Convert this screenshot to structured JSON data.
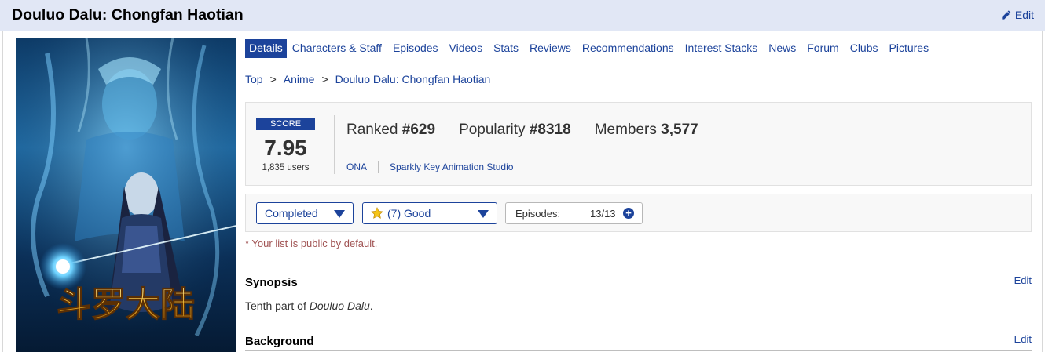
{
  "header": {
    "title": "Douluo Dalu: Chongfan Haotian",
    "edit_label": "Edit"
  },
  "poster": {
    "logo_text": "斗罗大陆"
  },
  "nav": {
    "tabs": [
      {
        "label": "Details",
        "active": true
      },
      {
        "label": "Characters & Staff"
      },
      {
        "label": "Episodes"
      },
      {
        "label": "Videos"
      },
      {
        "label": "Stats"
      },
      {
        "label": "Reviews"
      },
      {
        "label": "Recommendations"
      },
      {
        "label": "Interest Stacks"
      },
      {
        "label": "News"
      },
      {
        "label": "Forum"
      },
      {
        "label": "Clubs"
      },
      {
        "label": "Pictures"
      }
    ]
  },
  "breadcrumb": {
    "items": [
      "Top",
      "Anime",
      "Douluo Dalu: Chongfan Haotian"
    ],
    "separator": ">"
  },
  "stats": {
    "score_label": "SCORE",
    "score": "7.95",
    "users": "1,835 users",
    "ranked_label": "Ranked",
    "ranked_value": "#629",
    "popularity_label": "Popularity",
    "popularity_value": "#8318",
    "members_label": "Members",
    "members_value": "3,577",
    "type": "ONA",
    "studio": "Sparkly Key Animation Studio"
  },
  "my_list": {
    "status": "Completed",
    "score": "(7) Good",
    "episodes_label": "Episodes:",
    "episodes_value": "13/13",
    "plus_symbol": "+"
  },
  "notice": "* Your list is public by default.",
  "synopsis": {
    "title": "Synopsis",
    "edit_label": "Edit",
    "text_before": "Tenth part of ",
    "text_italic": "Douluo Dalu",
    "text_after": "."
  },
  "background": {
    "title": "Background",
    "edit_label": "Edit"
  },
  "colors": {
    "accent": "#1c439b",
    "header_bg": "#e1e7f5",
    "notice": "#a15454"
  }
}
